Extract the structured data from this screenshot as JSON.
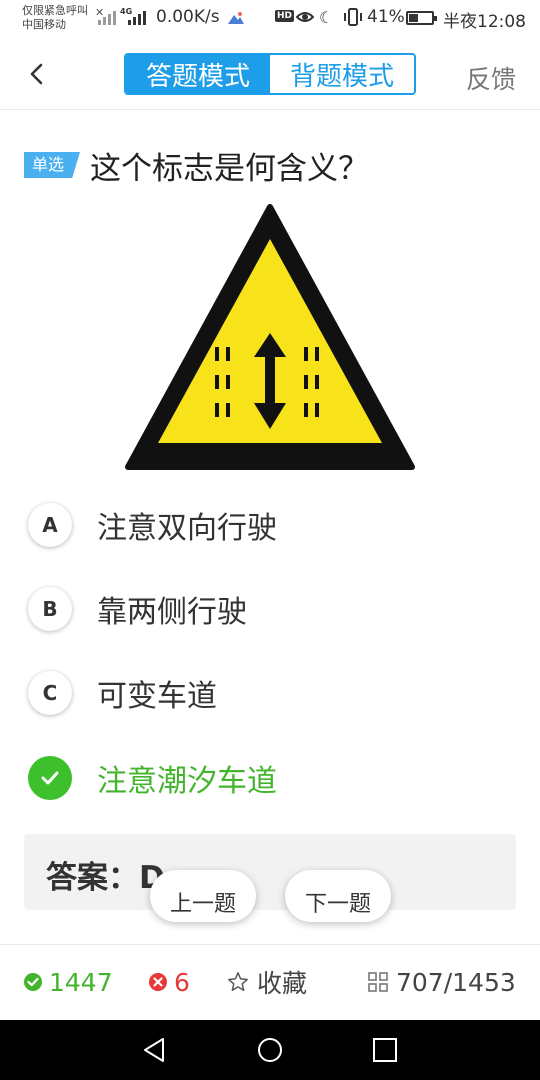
{
  "status_bar": {
    "carrier_line1": "仅限紧急呼叫",
    "carrier_line2": "中国移动",
    "network": "4G",
    "net_speed": "0.00K/s",
    "hd": "HD",
    "battery_percent": "41%",
    "battery_level": 0.41,
    "time": "半夜12:08"
  },
  "header": {
    "back_icon": "chevron-left-icon",
    "mode_tabs": [
      {
        "label": "答题模式",
        "active": true
      },
      {
        "label": "背题模式",
        "active": false
      }
    ],
    "feedback_label": "反馈"
  },
  "question": {
    "type_tag": "单选",
    "text": "这个标志是何含义？"
  },
  "options": [
    {
      "letter": "A",
      "text": "注意双向行驶",
      "state": "normal"
    },
    {
      "letter": "B",
      "text": "靠两侧行驶",
      "state": "normal"
    },
    {
      "letter": "C",
      "text": "可变车道",
      "state": "normal"
    },
    {
      "letter": "D",
      "text": "注意潮汐车道",
      "state": "correct"
    }
  ],
  "answer": {
    "label": "答案：D"
  },
  "nav_buttons": {
    "prev_label": "上一题",
    "next_label": "下一题"
  },
  "toolbar": {
    "right_count": "1447",
    "wrong_count": "6",
    "favorite_label": "收藏",
    "progress": "707/1453"
  },
  "colors": {
    "primary": "#1e9ee8",
    "correct": "#43b52c",
    "wrong": "#e8383a",
    "sign_yellow": "#f8e21a"
  }
}
